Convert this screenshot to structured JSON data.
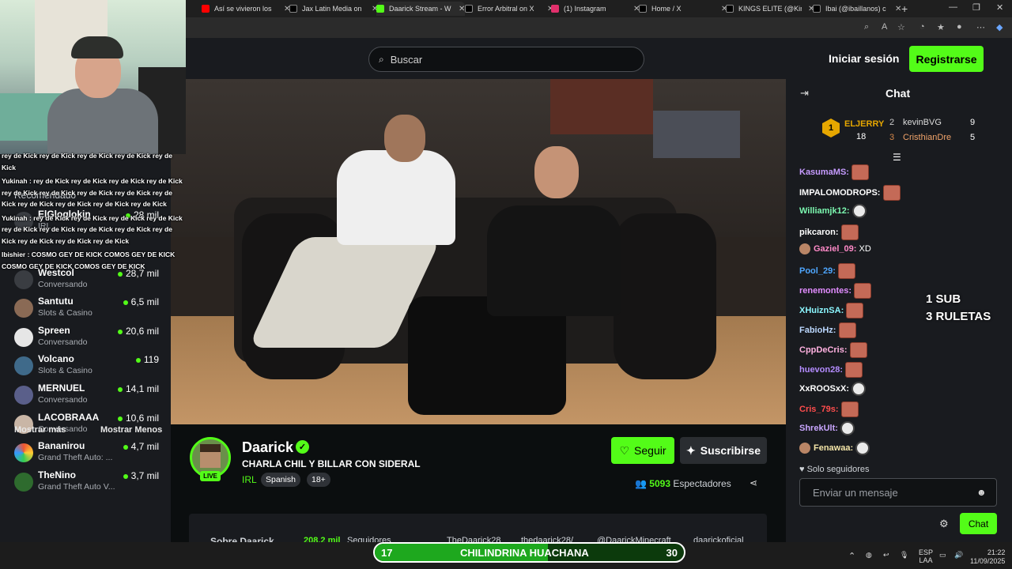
{
  "browser": {
    "tabs": [
      {
        "label": "Así se vivieron los",
        "color": "#ff0000"
      },
      {
        "label": "Jax Latin Media on",
        "color": "#000000"
      },
      {
        "label": "Daarick Stream - W",
        "color": "#53fc18"
      },
      {
        "label": "Error Arbitral on X",
        "color": "#000000"
      },
      {
        "label": "(1) Instagram",
        "color": "#e1306c"
      },
      {
        "label": "Home / X",
        "color": "#000000"
      },
      {
        "label": "KINGS ELITE (@Kin",
        "color": "#000000"
      },
      {
        "label": "Ibai (@ibaillanos) c",
        "color": "#000000"
      }
    ]
  },
  "header": {
    "search_placeholder": "Buscar",
    "login_label": "Iniciar sesión",
    "register_label": "Registrarse"
  },
  "sidebar": {
    "section_label": "Recomendado",
    "channels": [
      {
        "name": "ElGloglokin",
        "category": "IRL",
        "viewers": "28 mil"
      },
      {
        "name": "Westcol",
        "category": "Conversando",
        "viewers": "28,7 mil"
      },
      {
        "name": "Santutu",
        "category": "Slots & Casino",
        "viewers": "6,5 mil"
      },
      {
        "name": "Spreen",
        "category": "Conversando",
        "viewers": "20,6 mil"
      },
      {
        "name": "Volcano",
        "category": "Slots & Casino",
        "viewers": "119"
      },
      {
        "name": "MERNUEL",
        "category": "Conversando",
        "viewers": "14,1 mil"
      },
      {
        "name": "LACOBRAAA",
        "category": "Conversando",
        "viewers": "10,6 mil"
      },
      {
        "name": "Bananirou",
        "category": "Grand Theft Auto: ...",
        "viewers": "4,7 mil"
      },
      {
        "name": "TheNino",
        "category": "Grand Theft Auto V...",
        "viewers": "3,7 mil"
      }
    ],
    "show_more": "Mostrar más",
    "show_less": "Mostrar Menos"
  },
  "overlay_chat": [
    "rey de Kick rey de Kick rey de Kick rey de Kick rey de Kick",
    "Yukinah : rey de Kick rey de Kick rey de Kick rey de Kick rey de Kick rey de Kick rey de Kick rey de Kick rey de Kick rey de Kick rey de Kick rey de Kick rey de Kick",
    "Yukinah : rey de Kick rey de Kick rey de Kick rey de Kick rey de Kick rey de Kick rey de Kick rey de Kick rey de Kick rey de Kick rey de Kick rey de Kick",
    "Ibishier : COSMO GEY DE KICK COMOS GEY DE KICK COSMO GEY DE KICK COMOS GEY DE KICK"
  ],
  "stream": {
    "streamer": "Daarick",
    "title": "CHARLA CHIL Y BILLAR CON SIDERAL",
    "category": "IRL",
    "tags": [
      "Spanish",
      "18+"
    ],
    "live_label": "LIVE",
    "follow_label": "Seguir",
    "subscribe_label": "Suscribirse",
    "viewers_count": "5093",
    "viewers_label": "Espectadores",
    "about": {
      "title": "Sobre Daarick",
      "followers": "208,2 mil",
      "followers_label": "Seguidores",
      "links": [
        "TheDaarick28",
        "thedaarick28/",
        "@DaarickMinecraft",
        "daarickoficial"
      ]
    }
  },
  "chat": {
    "title": "Chat",
    "leaderboard": [
      {
        "rank": "1",
        "name": "ELJERRY",
        "value": "18"
      },
      {
        "rank": "2",
        "name": "kevinBVG",
        "value": "9"
      },
      {
        "rank": "3",
        "name": "CristhianDre",
        "value": "5"
      }
    ],
    "messages": [
      {
        "user": "KasumaMS",
        "color": "#c69bff",
        "text": "",
        "emote": "face"
      },
      {
        "user": "IMPALOMODROPS",
        "color": "#ffffff",
        "text": "",
        "emote": "face"
      },
      {
        "user": "Williamjk12",
        "color": "#7cf8b0",
        "text": "",
        "emote": "ghost"
      },
      {
        "user": "pikcaron",
        "color": "#ffffff",
        "text": "",
        "emote": "face"
      },
      {
        "user": "Gaziel_09",
        "color": "#ff8ac8",
        "text": "XD",
        "emote": "",
        "avatar": true
      },
      {
        "user": "Pool_29",
        "color": "#4ea6ff",
        "text": "",
        "emote": "face"
      },
      {
        "user": "renemontes",
        "color": "#e18cff",
        "text": "",
        "emote": "face"
      },
      {
        "user": "XHuiznSA",
        "color": "#8cf7ff",
        "text": "",
        "emote": "face"
      },
      {
        "user": "FabioHz",
        "color": "#bcd8ff",
        "text": "",
        "emote": "face"
      },
      {
        "user": "CppDeCris",
        "color": "#ffb1e0",
        "text": "",
        "emote": "face"
      },
      {
        "user": "huevon28",
        "color": "#b48cff",
        "text": "",
        "emote": "face"
      },
      {
        "user": "XxROOSxX",
        "color": "#ffffff",
        "text": "",
        "emote": "ghost"
      },
      {
        "user": "Cris_79s",
        "color": "#ff4d4d",
        "text": "",
        "emote": "face"
      },
      {
        "user": "ShrekUlt",
        "color": "#c9a6ff",
        "text": "",
        "emote": "ghost"
      },
      {
        "user": "Fenawaa",
        "color": "#f5e6a8",
        "text": "",
        "emote": "ghost",
        "avatar": true
      }
    ],
    "overlay_note": [
      "1 SUB",
      "3 RULETAS"
    ],
    "followers_only": "Solo seguidores",
    "input_placeholder": "Enviar un mensaje",
    "send_label": "Chat"
  },
  "goal_bar": {
    "left": "17",
    "label": "CHILINDRINA HUACHANA",
    "right": "30",
    "progress": 0.56
  },
  "taskbar": {
    "lang_top": "ESP",
    "lang_bottom": "LAA",
    "time": "21:22",
    "date": "11/09/2025"
  }
}
